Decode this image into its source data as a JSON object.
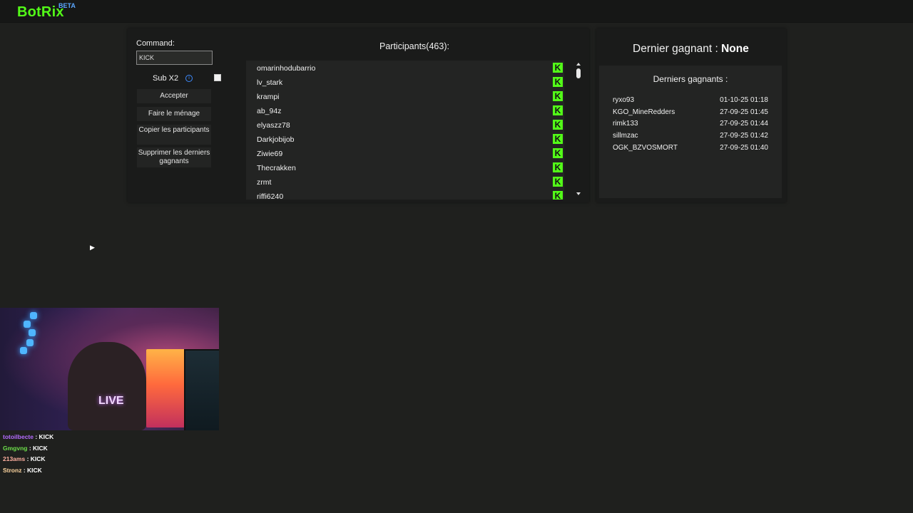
{
  "app": {
    "name": "BotRix",
    "badge": "BETA"
  },
  "command": {
    "label": "Command:",
    "value": "KICK"
  },
  "sub": {
    "label": "Sub X2"
  },
  "buttons": {
    "accept": "Accepter",
    "clean": "Faire le ménage",
    "copy": "Copier les participants",
    "delete": "Supprimer les derniers gagnants"
  },
  "participants": {
    "title": "Participants(463):",
    "badge": "K",
    "items": [
      "omarinhodubarrio",
      "lv_stark",
      "krampi",
      "ab_94z",
      "elyaszz78",
      "Darkjobijob",
      "Ziwie69",
      "Thecrakken",
      "zrmt",
      "riffi6240"
    ]
  },
  "last_winner": {
    "label": "Dernier gagnant :",
    "value": "None"
  },
  "winners": {
    "title": "Derniers gagnants :",
    "items": [
      {
        "name": "ryxo93",
        "date": "01-10-25 01:18"
      },
      {
        "name": "KGO_MineRedders",
        "date": "27-09-25 01:45"
      },
      {
        "name": "rimk133",
        "date": "27-09-25 01:44"
      },
      {
        "name": "sillmzac",
        "date": "27-09-25 01:42"
      },
      {
        "name": "OGK_BZVOSMORT",
        "date": "27-09-25 01:40"
      }
    ]
  },
  "webcam": {
    "sign": "LIVE"
  },
  "chat": [
    {
      "user": "totoilbecte",
      "msg": "KICK"
    },
    {
      "user": "Gmgvng",
      "msg": "KICK"
    },
    {
      "user": "213ams",
      "msg": "KICK"
    },
    {
      "user": "Stronz",
      "msg": "KICK"
    }
  ]
}
